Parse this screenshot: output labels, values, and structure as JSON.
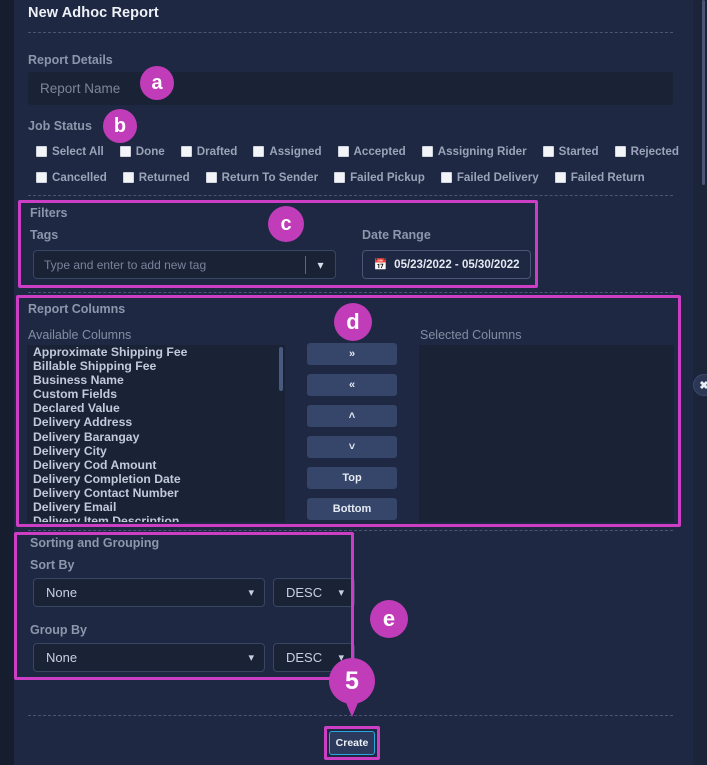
{
  "header": {
    "title": "New Adhoc Report"
  },
  "report_details": {
    "label": "Report Details",
    "name_placeholder": "Report Name",
    "name_value": ""
  },
  "job_status": {
    "label": "Job Status",
    "row1": [
      "Select All",
      "Done",
      "Drafted",
      "Assigned",
      "Accepted",
      "Assigning Rider",
      "Started",
      "Rejected"
    ],
    "row2": [
      "Cancelled",
      "Returned",
      "Return To Sender",
      "Failed Pickup",
      "Failed Delivery",
      "Failed Return"
    ]
  },
  "filters": {
    "label": "Filters",
    "tags_label": "Tags",
    "tags_placeholder": "Type and enter to add new tag",
    "date_label": "Date Range",
    "date_value": "05/23/2022 - 05/30/2022",
    "calendar_icon": "calendar-icon",
    "caret_icon": "chevron-down-icon"
  },
  "report_columns": {
    "label": "Report Columns",
    "available_label": "Available Columns",
    "selected_label": "Selected Columns",
    "available": [
      "Approximate Shipping Fee",
      "Billable Shipping Fee",
      "Business Name",
      "Custom Fields",
      "Declared Value",
      "Delivery Address",
      "Delivery Barangay",
      "Delivery City",
      "Delivery Cod Amount",
      "Delivery Completion Date",
      "Delivery Contact Number",
      "Delivery Email",
      "Delivery Item Description"
    ],
    "selected": [],
    "buttons": [
      {
        "label": "»",
        "name": "move-right-button"
      },
      {
        "label": "«",
        "name": "move-left-button"
      },
      {
        "label": "˄",
        "name": "move-up-button"
      },
      {
        "label": "˅",
        "name": "move-down-button"
      },
      {
        "label": "Top",
        "name": "move-top-button"
      },
      {
        "label": "Bottom",
        "name": "move-bottom-button"
      }
    ]
  },
  "sorting": {
    "label": "Sorting and Grouping",
    "sort_by_label": "Sort By",
    "sort_by_value": "None",
    "sort_dir_value": "DESC",
    "group_by_label": "Group By",
    "group_by_value": "None",
    "group_dir_value": "DESC"
  },
  "footer": {
    "create_label": "Create"
  },
  "overlay": {
    "markers": [
      {
        "id": "a",
        "label": "a"
      },
      {
        "id": "b",
        "label": "b"
      },
      {
        "id": "c",
        "label": "c"
      },
      {
        "id": "d",
        "label": "d"
      },
      {
        "id": "e",
        "label": "e"
      },
      {
        "id": "5",
        "label": "5"
      }
    ],
    "accent_color": "#c13cb8",
    "highlight_color": "#cc3fc4",
    "close_icon": "close-icon"
  }
}
